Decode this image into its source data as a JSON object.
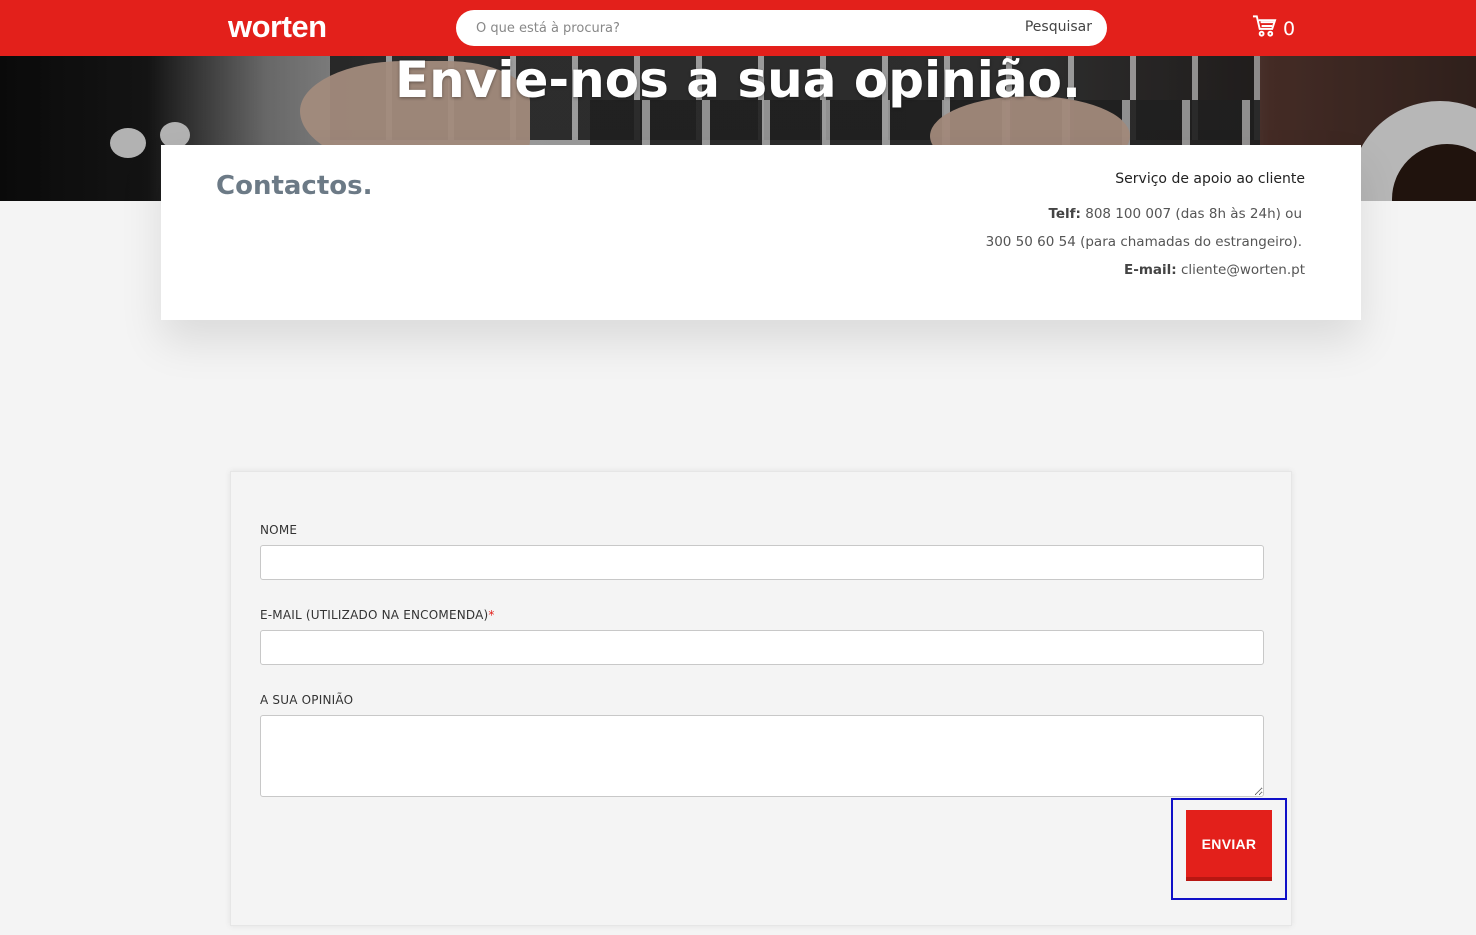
{
  "header": {
    "logo_text": "worten",
    "search": {
      "placeholder": "O que está à procura?",
      "button_label": "Pesquisar"
    },
    "cart": {
      "icon": "cart-icon",
      "count": "0"
    },
    "brand_color": "#e3201b"
  },
  "hero": {
    "title": "Envie-nos a sua opinião."
  },
  "contacts": {
    "title": "Contactos.",
    "support_heading": "Serviço de apoio ao cliente",
    "phone_label": "Telf:",
    "phone_number": "808 100 007",
    "phone_hours": "(das 8h às 24h) ou",
    "abroad_number": "300 50 60 54",
    "abroad_note": "(para chamadas do estrangeiro).",
    "email_label": "E-mail:",
    "email_value": "cliente@worten.pt"
  },
  "form": {
    "name_label": "NOME",
    "name_value": "",
    "email_label": "E-MAIL (UTILIZADO NA ENCOMENDA)",
    "email_required_mark": "*",
    "email_value": "",
    "opinion_label": "A SUA OPINIÃO",
    "opinion_value": "",
    "submit_label": "ENVIAR",
    "highlight_color": "#1010c8"
  }
}
